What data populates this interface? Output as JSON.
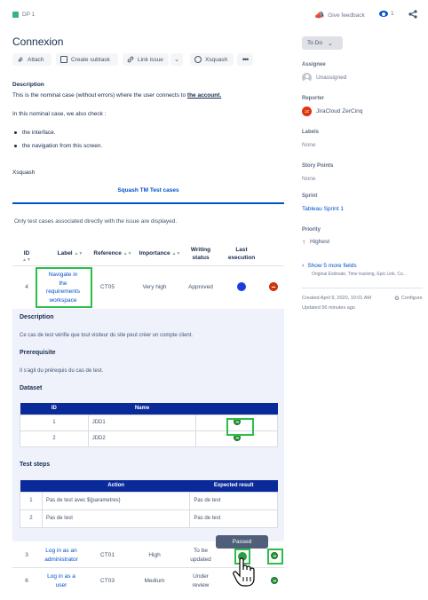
{
  "header": {
    "issue_key": "DP 1",
    "give_feedback": "Give feedback",
    "watchers_count": "1"
  },
  "issue": {
    "title": "Connexion",
    "actions": {
      "attach": "Attach",
      "create_subtask": "Create subtask",
      "link_issue": "Link issue",
      "xsquash": "Xsquash"
    },
    "description_heading": "Description",
    "description_line1_prefix": "This is the nominal case (without errors) where the user connects to ",
    "description_line1_link": "the account.",
    "description_line2": "In this nominal case, we also check :",
    "bullets": [
      "the interface.",
      "the navigation from this screen."
    ]
  },
  "xsquash": {
    "heading": "Xsquash",
    "tab": "Squash TM Test cases",
    "note": "Only test cases associated directly with the issue are displayed.",
    "columns": [
      "ID",
      "Label",
      "Reference",
      "Importance",
      "Writing status",
      "Last execution"
    ],
    "rows": [
      {
        "id": "4",
        "label": "Navigate in the requirements workspace",
        "label_lines": [
          "Navigate in",
          "the",
          "requirements",
          "workspace"
        ],
        "reference": "CT05",
        "importance": "Very high",
        "status": "Approved"
      },
      {
        "id": "3",
        "label": "Log in as an administrator",
        "label_lines": [
          "Log in as an",
          "administrator"
        ],
        "reference": "CT01",
        "importance": "High",
        "status_lines": [
          "To be",
          "updated"
        ]
      },
      {
        "id": "6",
        "label": "Log in as a user",
        "label_lines": [
          "Log in as a",
          "user"
        ],
        "reference": "CT03",
        "importance": "Medium",
        "status_lines": [
          "Under",
          "review"
        ]
      }
    ],
    "detail": {
      "description_heading": "Description",
      "description_text": "Ce cas de test vérifie que tout visiteur du site peut créer un compte client.",
      "prerequisite_heading": "Prerequisite",
      "prerequisite_text": "Il s'agit du prérequis du cas de test.",
      "dataset_heading": "Dataset",
      "dataset_columns": [
        "ID",
        "Name"
      ],
      "dataset_rows": [
        {
          "id": "1",
          "name": "JDD1"
        },
        {
          "id": "2",
          "name": "JDD2"
        }
      ],
      "steps_heading": "Test steps",
      "steps_columns": [
        "Action",
        "Expected result"
      ],
      "steps_rows": [
        {
          "n": "1",
          "action": "Pas de test avec ${parametres}",
          "expected": "Pas de test"
        },
        {
          "n": "2",
          "action": "Pas de test",
          "expected": "Pas de test"
        }
      ]
    },
    "tooltip": "Passed"
  },
  "sidebar": {
    "status": "To Do",
    "assignee_label": "Assignee",
    "assignee": "Unassigned",
    "reporter_label": "Reporter",
    "reporter": "JiraCloud ZerCinq",
    "reporter_initials": "JZ",
    "labels_label": "Labels",
    "labels": "None",
    "story_points_label": "Story Points",
    "story_points": "None",
    "sprint_label": "Sprint",
    "sprint": "Tableau Sprint 1",
    "priority_label": "Priority",
    "priority": "Highest",
    "more_fields": "Show 5 more fields",
    "more_fields_sub": "Original Estimate, Time tracking, Epic Link, Co...",
    "created": "Created April 9, 2020, 10:01 AM",
    "updated": "Updated 56 minutes ago",
    "configure": "Configure"
  },
  "colors": {
    "accent": "#0052cc",
    "table_header": "#0a2a9a",
    "highlight": "#2bbf4a",
    "passed": "#2e9b40",
    "failed": "#de350b",
    "running": "#1b3ce0"
  }
}
